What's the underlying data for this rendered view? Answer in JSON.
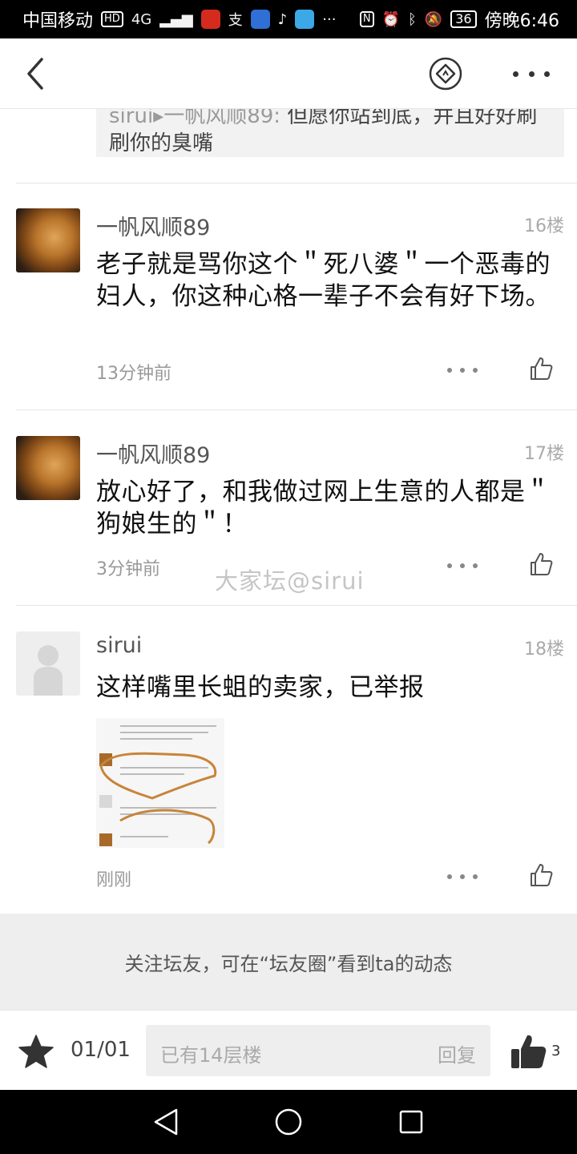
{
  "status_bar": {
    "carrier": "中国移动",
    "network": "4G",
    "hd": "HD",
    "nfc": "N",
    "battery": "36",
    "time": "傍晚6:46",
    "more": "···"
  },
  "quote": {
    "user": "sirui▸一帆风顺89:",
    "text": "但愿你站到底，并且好好刷刷你的臭嘴"
  },
  "posts": [
    {
      "username": "一帆风顺89",
      "floor": "16楼",
      "text": "老子就是骂你这个＂死八婆＂一个恶毒的妇人，你这种心格一辈子不会有好下场。",
      "time": "13分钟前"
    },
    {
      "username": "一帆风顺89",
      "floor": "17楼",
      "text": "放心好了，和我做过网上生意的人都是＂狗娘生的＂！",
      "time": "3分钟前"
    },
    {
      "username": "sirui",
      "floor": "18楼",
      "text": "这样嘴里长蛆的卖家，已举报",
      "time": "刚刚"
    }
  ],
  "watermark": "大家坛@sirui",
  "follow_banner": "关注坛友，可在“坛友圈”看到ta的动态",
  "bottom_bar": {
    "page": "01/01",
    "reply_placeholder": "已有14层楼",
    "reply_label": "回复",
    "like_count": "3"
  },
  "colors": {
    "accent": "#333333",
    "banner_bg": "#eeeeee"
  }
}
